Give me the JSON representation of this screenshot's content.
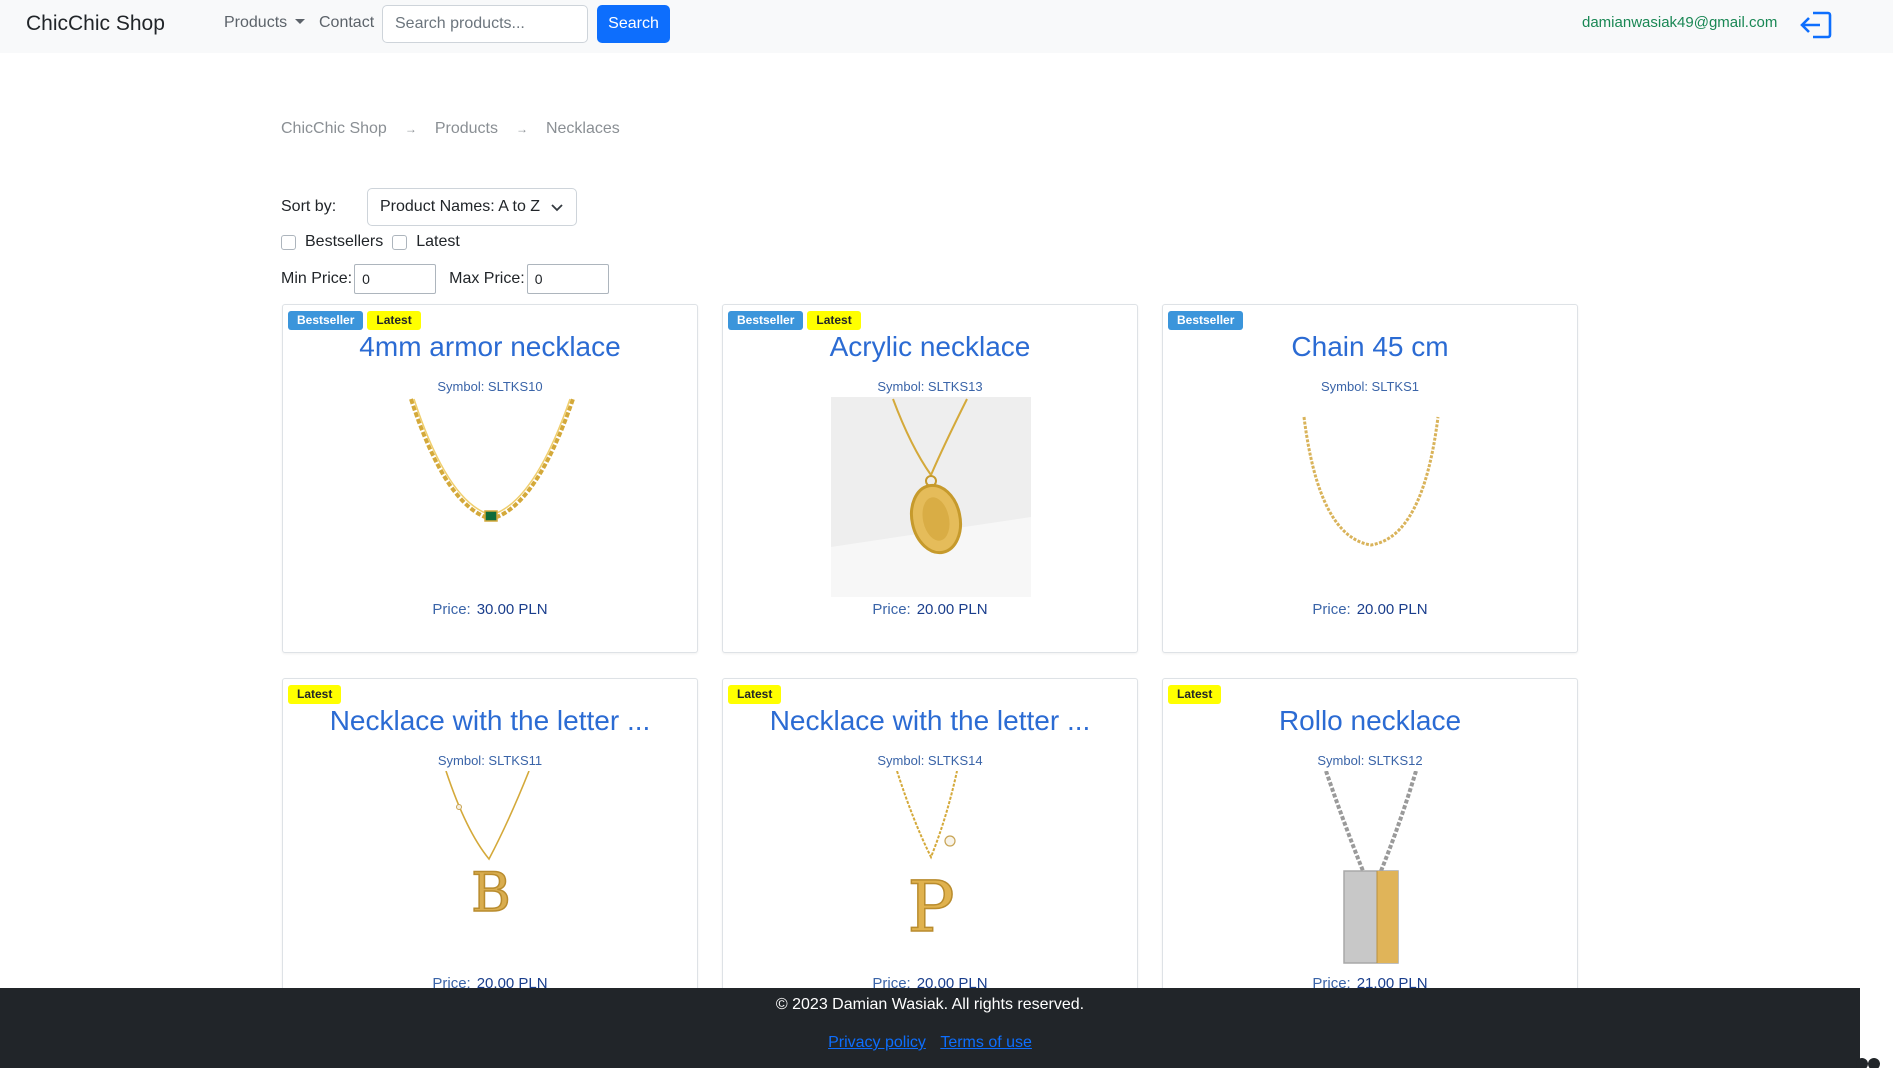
{
  "navbar": {
    "brand": "ChicChic Shop",
    "products_label": "Products",
    "contact_label": "Contact",
    "search_placeholder": "Search products...",
    "search_button": "Search",
    "user_email": "damianwasiak49@gmail.com",
    "logout_icon": "logout-icon"
  },
  "breadcrumb": [
    "ChicChic Shop",
    "Products",
    "Necklaces"
  ],
  "filters": {
    "sort_label": "Sort by:",
    "sort_value": "Product Names: A to Z",
    "bestsellers_label": "Bestsellers",
    "latest_label": "Latest",
    "bestsellers_checked": false,
    "latest_checked": false,
    "min_price_label": "Min Price:",
    "min_price_value": "0",
    "max_price_label": "Max Price:",
    "max_price_value": "0"
  },
  "products": [
    {
      "title": "4mm armor necklace",
      "symbol": "Symbol: SLTKS10",
      "price_label": "Price:",
      "price": "30.00 PLN",
      "badges": [
        "Bestseller",
        "Latest"
      ]
    },
    {
      "title": "Acrylic necklace",
      "symbol": "Symbol: SLTKS13",
      "price_label": "Price:",
      "price": "20.00 PLN",
      "badges": [
        "Bestseller",
        "Latest"
      ]
    },
    {
      "title": "Chain 45 cm",
      "symbol": "Symbol: SLTKS1",
      "price_label": "Price:",
      "price": "20.00 PLN",
      "badges": [
        "Bestseller"
      ]
    },
    {
      "title": "Necklace with the letter ...",
      "symbol": "Symbol: SLTKS11",
      "price_label": "Price:",
      "price": "20.00 PLN",
      "badges": [
        "Latest"
      ]
    },
    {
      "title": "Necklace with the letter ...",
      "symbol": "Symbol: SLTKS14",
      "price_label": "Price:",
      "price": "20.00 PLN",
      "badges": [
        "Latest"
      ]
    },
    {
      "title": "Rollo necklace",
      "symbol": "Symbol: SLTKS12",
      "price_label": "Price:",
      "price": "21.00 PLN",
      "badges": [
        "Latest"
      ]
    }
  ],
  "footer": {
    "copyright": "© 2023 Damian Wasiak. All rights reserved.",
    "privacy": "Privacy policy",
    "terms": "Terms of use"
  },
  "colors": {
    "primary": "#0d6efd",
    "bestseller_badge": "#3b95db",
    "latest_badge": "#ffff00",
    "email": "#198754",
    "footer_bg": "#212529"
  }
}
